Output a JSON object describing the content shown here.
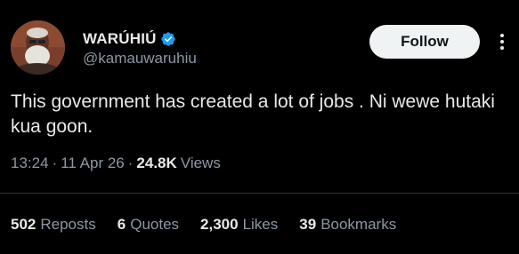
{
  "author": {
    "display_name": "WARÚHIÚ",
    "handle": "@kamauwaruhiu",
    "verified": true,
    "avatar_icon": "avatar-portrait-icon"
  },
  "follow_button": {
    "label": "Follow"
  },
  "more_icon": "more-dots-icon",
  "tweet": {
    "text": "This government has created a lot of jobs . Ni wewe hutaki kua goon."
  },
  "meta": {
    "time": "13:24",
    "dot": "·",
    "date": "11 Apr 26",
    "views_count": "24.8K",
    "views_label": "Views"
  },
  "stats": [
    {
      "count": "502",
      "label": "Reposts"
    },
    {
      "count": "6",
      "label": "Quotes"
    },
    {
      "count": "2,300",
      "label": "Likes"
    },
    {
      "count": "39",
      "label": "Bookmarks"
    }
  ],
  "colors": {
    "background": "#000000",
    "text_primary": "#e7e9ea",
    "text_secondary": "#8b98a5",
    "verified_badge": "#1d9bf0",
    "follow_bg": "#eff3f4",
    "divider": "#2f3336"
  }
}
